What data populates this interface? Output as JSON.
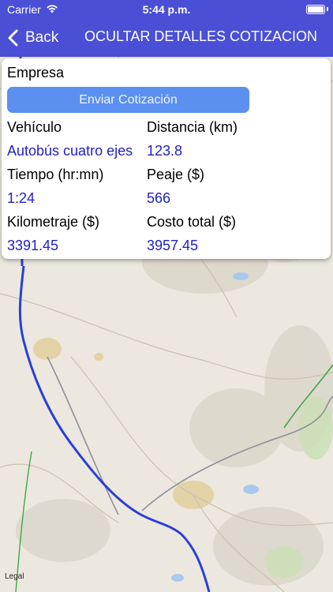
{
  "status_bar": {
    "carrier": "Carrier",
    "time": "5:44 p.m."
  },
  "nav": {
    "back_label": "Back",
    "title": "OCULTAR DETALLES COTIZACION"
  },
  "card": {
    "company_label": "Empresa",
    "send_button_label": "Enviar Cotización",
    "fields": [
      {
        "label": "Vehículo",
        "value": "Autobús cuatro ejes"
      },
      {
        "label": "Distancia (km)",
        "value": "123.8"
      },
      {
        "label": "Tiempo (hr:mn)",
        "value": "1:24"
      },
      {
        "label": "Peaje ($)",
        "value": "566"
      },
      {
        "label": "Kilometraje ($)",
        "value": "3391.45"
      },
      {
        "label": "Costo total ($)",
        "value": "3957.45"
      }
    ]
  },
  "map": {
    "legal_label": "Legal"
  },
  "colors": {
    "header": "#4a4fd6",
    "button": "#5b90f0",
    "value_text": "#1f1fc8",
    "route": "#2a3fd8"
  }
}
